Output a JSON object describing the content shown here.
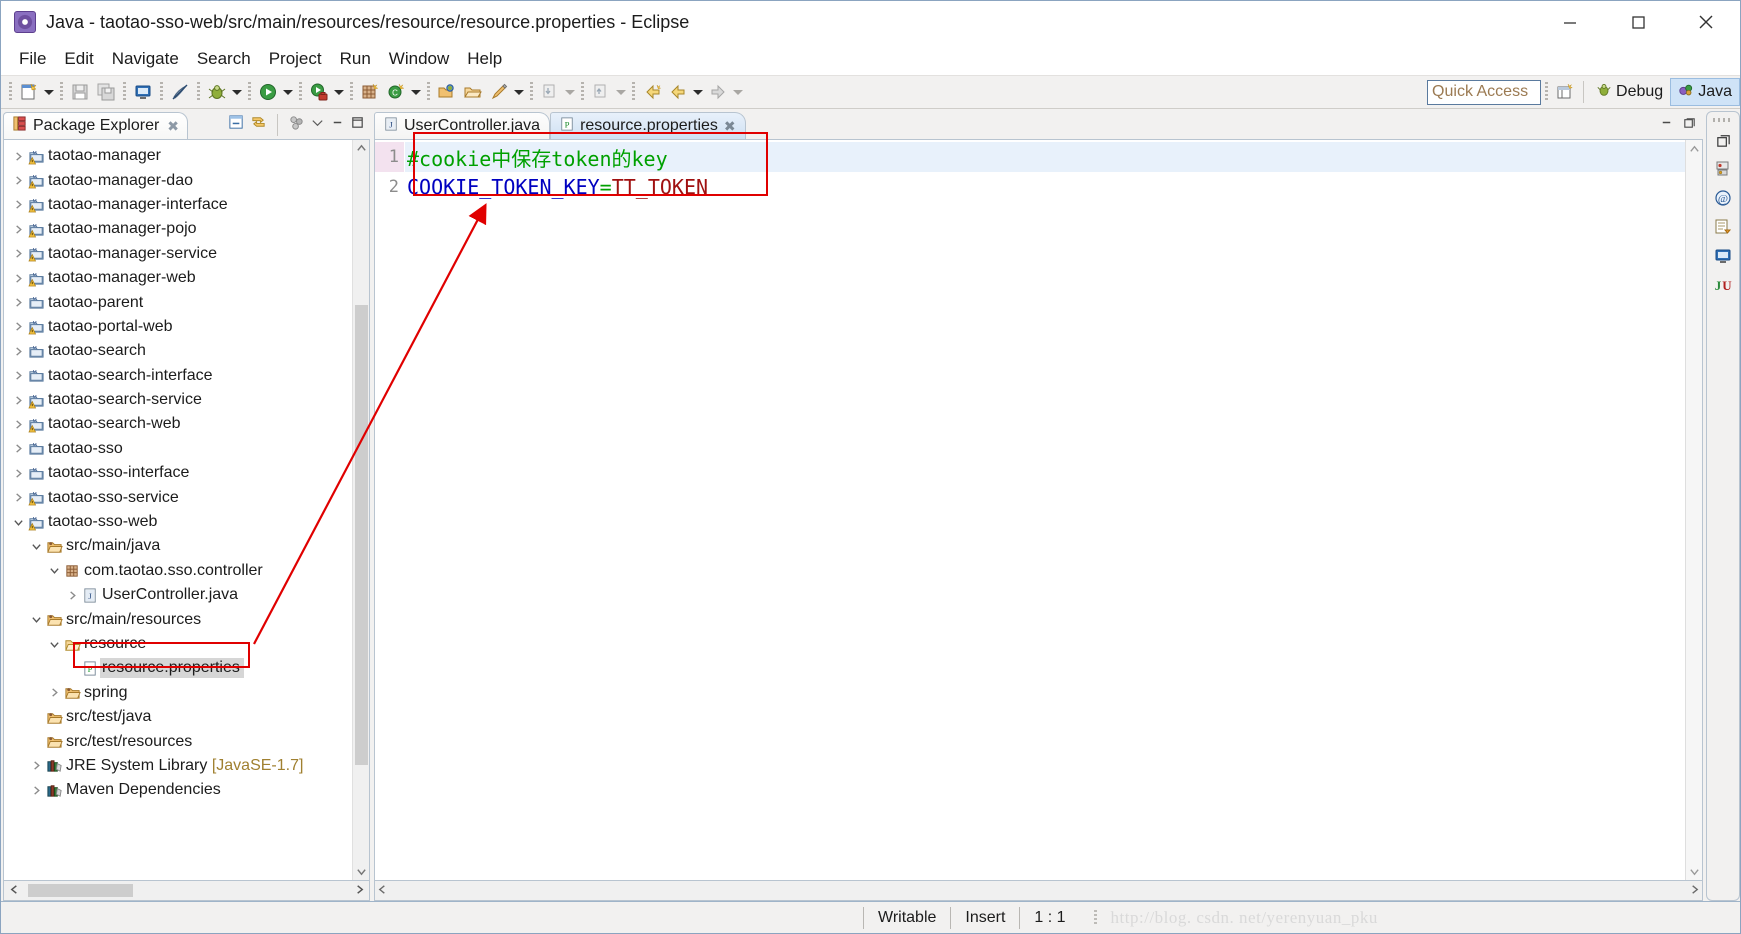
{
  "window": {
    "title": "Java - taotao-sso-web/src/main/resources/resource/resource.properties - Eclipse",
    "app_icon": "eclipse-icon",
    "minimize_label": "—",
    "maximize_label": "☐",
    "close_label": "✕"
  },
  "menubar": {
    "items": [
      "File",
      "Edit",
      "Navigate",
      "Search",
      "Project",
      "Run",
      "Window",
      "Help"
    ]
  },
  "toolbar": {
    "quick_access_placeholder": "Quick Access",
    "quick_access_value": "",
    "perspectives": [
      {
        "label": "Debug",
        "icon": "debug-perspective-icon",
        "active": false
      },
      {
        "label": "Java",
        "icon": "java-perspective-icon",
        "active": true
      }
    ],
    "open_perspective_icon": "open-perspective-icon"
  },
  "package_explorer": {
    "title": "Package Explorer",
    "close_label": "✖",
    "view_icons": [
      "collapse-all-icon",
      "link-with-editor-icon",
      "view-menu-filter-icon",
      "view-menu-icon",
      "minimize-icon",
      "maximize-icon"
    ],
    "tree": [
      {
        "label": "taotao-manager",
        "indent": 0,
        "twisty": "collapsed",
        "icon": "maven-project-warning-icon"
      },
      {
        "label": "taotao-manager-dao",
        "indent": 0,
        "twisty": "collapsed",
        "icon": "maven-project-warning-icon"
      },
      {
        "label": "taotao-manager-interface",
        "indent": 0,
        "twisty": "collapsed",
        "icon": "maven-project-warning-icon"
      },
      {
        "label": "taotao-manager-pojo",
        "indent": 0,
        "twisty": "collapsed",
        "icon": "maven-project-warning-icon"
      },
      {
        "label": "taotao-manager-service",
        "indent": 0,
        "twisty": "collapsed",
        "icon": "maven-project-warning-icon"
      },
      {
        "label": "taotao-manager-web",
        "indent": 0,
        "twisty": "collapsed",
        "icon": "maven-project-warning-icon"
      },
      {
        "label": "taotao-parent",
        "indent": 0,
        "twisty": "collapsed",
        "icon": "maven-project-icon"
      },
      {
        "label": "taotao-portal-web",
        "indent": 0,
        "twisty": "collapsed",
        "icon": "maven-project-warning-icon"
      },
      {
        "label": "taotao-search",
        "indent": 0,
        "twisty": "collapsed",
        "icon": "maven-project-icon"
      },
      {
        "label": "taotao-search-interface",
        "indent": 0,
        "twisty": "collapsed",
        "icon": "maven-project-icon"
      },
      {
        "label": "taotao-search-service",
        "indent": 0,
        "twisty": "collapsed",
        "icon": "maven-project-warning-icon"
      },
      {
        "label": "taotao-search-web",
        "indent": 0,
        "twisty": "collapsed",
        "icon": "maven-project-warning-icon"
      },
      {
        "label": "taotao-sso",
        "indent": 0,
        "twisty": "collapsed",
        "icon": "maven-project-icon"
      },
      {
        "label": "taotao-sso-interface",
        "indent": 0,
        "twisty": "collapsed",
        "icon": "maven-project-icon"
      },
      {
        "label": "taotao-sso-service",
        "indent": 0,
        "twisty": "collapsed",
        "icon": "maven-project-warning-icon"
      },
      {
        "label": "taotao-sso-web",
        "indent": 0,
        "twisty": "expanded",
        "icon": "maven-project-warning-icon"
      },
      {
        "label": "src/main/java",
        "indent": 1,
        "twisty": "expanded",
        "icon": "source-folder-icon"
      },
      {
        "label": "com.taotao.sso.controller",
        "indent": 2,
        "twisty": "expanded",
        "icon": "package-icon"
      },
      {
        "label": "UserController.java",
        "indent": 3,
        "twisty": "collapsed",
        "icon": "java-file-icon"
      },
      {
        "label": "src/main/resources",
        "indent": 1,
        "twisty": "expanded",
        "icon": "source-folder-icon"
      },
      {
        "label": "resource",
        "indent": 2,
        "twisty": "expanded",
        "icon": "folder-open-icon"
      },
      {
        "label": "resource.properties",
        "indent": 3,
        "twisty": "none",
        "icon": "properties-file-icon",
        "selected": true
      },
      {
        "label": "spring",
        "indent": 2,
        "twisty": "collapsed",
        "icon": "source-folder-icon"
      },
      {
        "label": "src/test/java",
        "indent": 1,
        "twisty": "none",
        "icon": "source-folder-icon"
      },
      {
        "label": "src/test/resources",
        "indent": 1,
        "twisty": "none",
        "icon": "source-folder-icon"
      },
      {
        "label": "JRE System Library",
        "suffix": " [JavaSE-1.7]",
        "indent": 1,
        "twisty": "collapsed",
        "icon": "library-icon"
      },
      {
        "label": "Maven Dependencies",
        "indent": 1,
        "twisty": "collapsed",
        "icon": "library-icon"
      }
    ],
    "hscroll_left": "‹",
    "hscroll_right": "›",
    "vscroll_up": "▲",
    "vscroll_down": "▼"
  },
  "editor": {
    "tabs": [
      {
        "label": "UserController.java",
        "icon": "java-file-icon",
        "active": false,
        "close": "✖"
      },
      {
        "label": "resource.properties",
        "icon": "properties-file-icon",
        "active": true,
        "close": "✖"
      }
    ],
    "minimize_icon": "minimize-icon",
    "maximize_icon": "maximize-icon",
    "lines": [
      {
        "number": "1",
        "current": true,
        "tokens": [
          {
            "text": "#cookie中保存token的key",
            "type": "comment"
          }
        ]
      },
      {
        "number": "2",
        "current": false,
        "tokens": [
          {
            "text": "COOKIE_TOKEN_KEY",
            "type": "key"
          },
          {
            "text": "=",
            "type": "eq"
          },
          {
            "text": "TT_TOKEN",
            "type": "val"
          }
        ]
      }
    ],
    "hscroll_left": "‹",
    "hscroll_right": "›",
    "vscroll_up": "▲",
    "vscroll_down": "▼"
  },
  "fastview": {
    "icons": [
      "restore-icon",
      "servers-view-icon",
      "at-sign-view-icon",
      "outline-view-icon",
      "console-view-icon",
      "junit-view-icon"
    ]
  },
  "statusbar": {
    "writable": "Writable",
    "insert_mode": "Insert",
    "position": "1 : 1",
    "watermark": "http://blog. csdn. net/yerenyuan_pku"
  },
  "colors": {
    "comment_green": "#00a000",
    "key_blue": "#0000c0",
    "value_red": "#a01010",
    "annotation_red": "#e00000",
    "current_line": "#e8f1fb",
    "selection_grey": "#d6d6d6",
    "perspective_active": "#cfe3f7"
  }
}
